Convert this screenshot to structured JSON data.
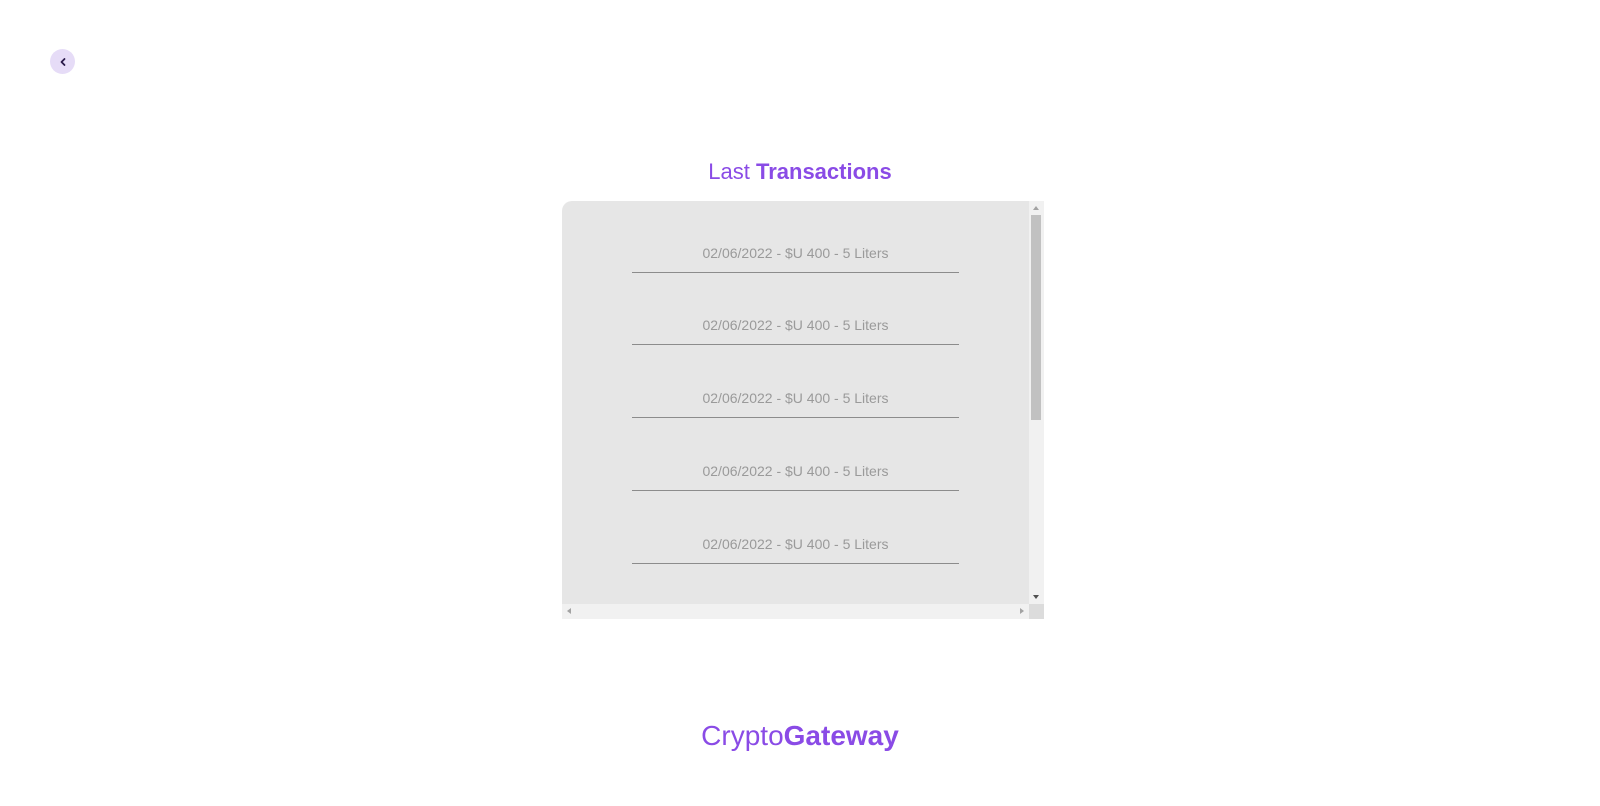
{
  "nav": {
    "back_icon": "chevron-left-icon"
  },
  "header": {
    "title_light": "Last ",
    "title_bold": "Transactions"
  },
  "transactions": [
    {
      "text": "02/06/2022 - $U 400 - 5 Liters"
    },
    {
      "text": "02/06/2022 - $U 400 - 5 Liters"
    },
    {
      "text": "02/06/2022 - $U 400 - 5 Liters"
    },
    {
      "text": "02/06/2022 - $U 400 - 5 Liters"
    },
    {
      "text": "02/06/2022 - $U 400 - 5 Liters"
    }
  ],
  "footer": {
    "brand_light": "Crypto",
    "brand_bold": "Gateway"
  },
  "colors": {
    "accent": "#8a4be6",
    "accent_light": "#e6dcf7",
    "panel_bg": "#e6e6e6",
    "item_text": "#9a9a9a",
    "divider": "#8c8c8c"
  }
}
